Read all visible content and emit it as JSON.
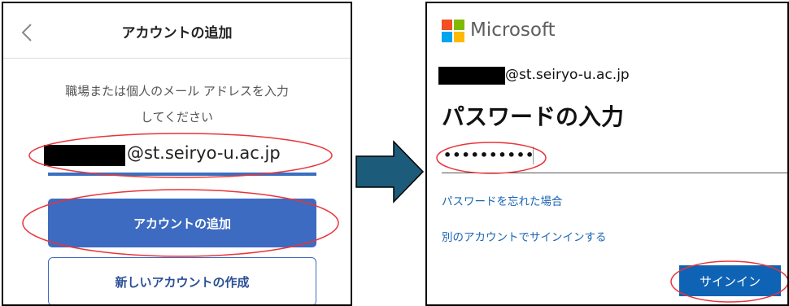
{
  "left_screen": {
    "header": {
      "title": "アカウントの追加",
      "back_icon": "chevron-left-icon"
    },
    "instruction_line1": "職場または個人のメール アドレスを入力",
    "instruction_line2": "してください",
    "email_input": {
      "value_visible": "@st.seiryo-u.ac.jp",
      "redacted": true
    },
    "add_account_button": "アカウントの追加",
    "create_account_button": "新しいアカウントの作成"
  },
  "right_screen": {
    "brand": {
      "name": "Microsoft",
      "logo": "microsoft-logo",
      "colors": [
        "#f25022",
        "#7fba00",
        "#00a4ef",
        "#ffb900"
      ]
    },
    "user_id": {
      "value_visible": "@st.seiryo-u.ac.jp",
      "redacted": true
    },
    "title": "パスワードの入力",
    "password_masked": "••••••••••",
    "forgot_password_link": "パスワードを忘れた場合",
    "other_account_link": "別のアカウントでサインインする",
    "signin_button": "サインイン"
  },
  "colors": {
    "primary_blue": "#3d6bc1",
    "ms_blue": "#0f63b5",
    "link_blue": "#1a66b3",
    "highlight_red": "#e8343a",
    "arrow_fill": "#1d5b7a"
  }
}
